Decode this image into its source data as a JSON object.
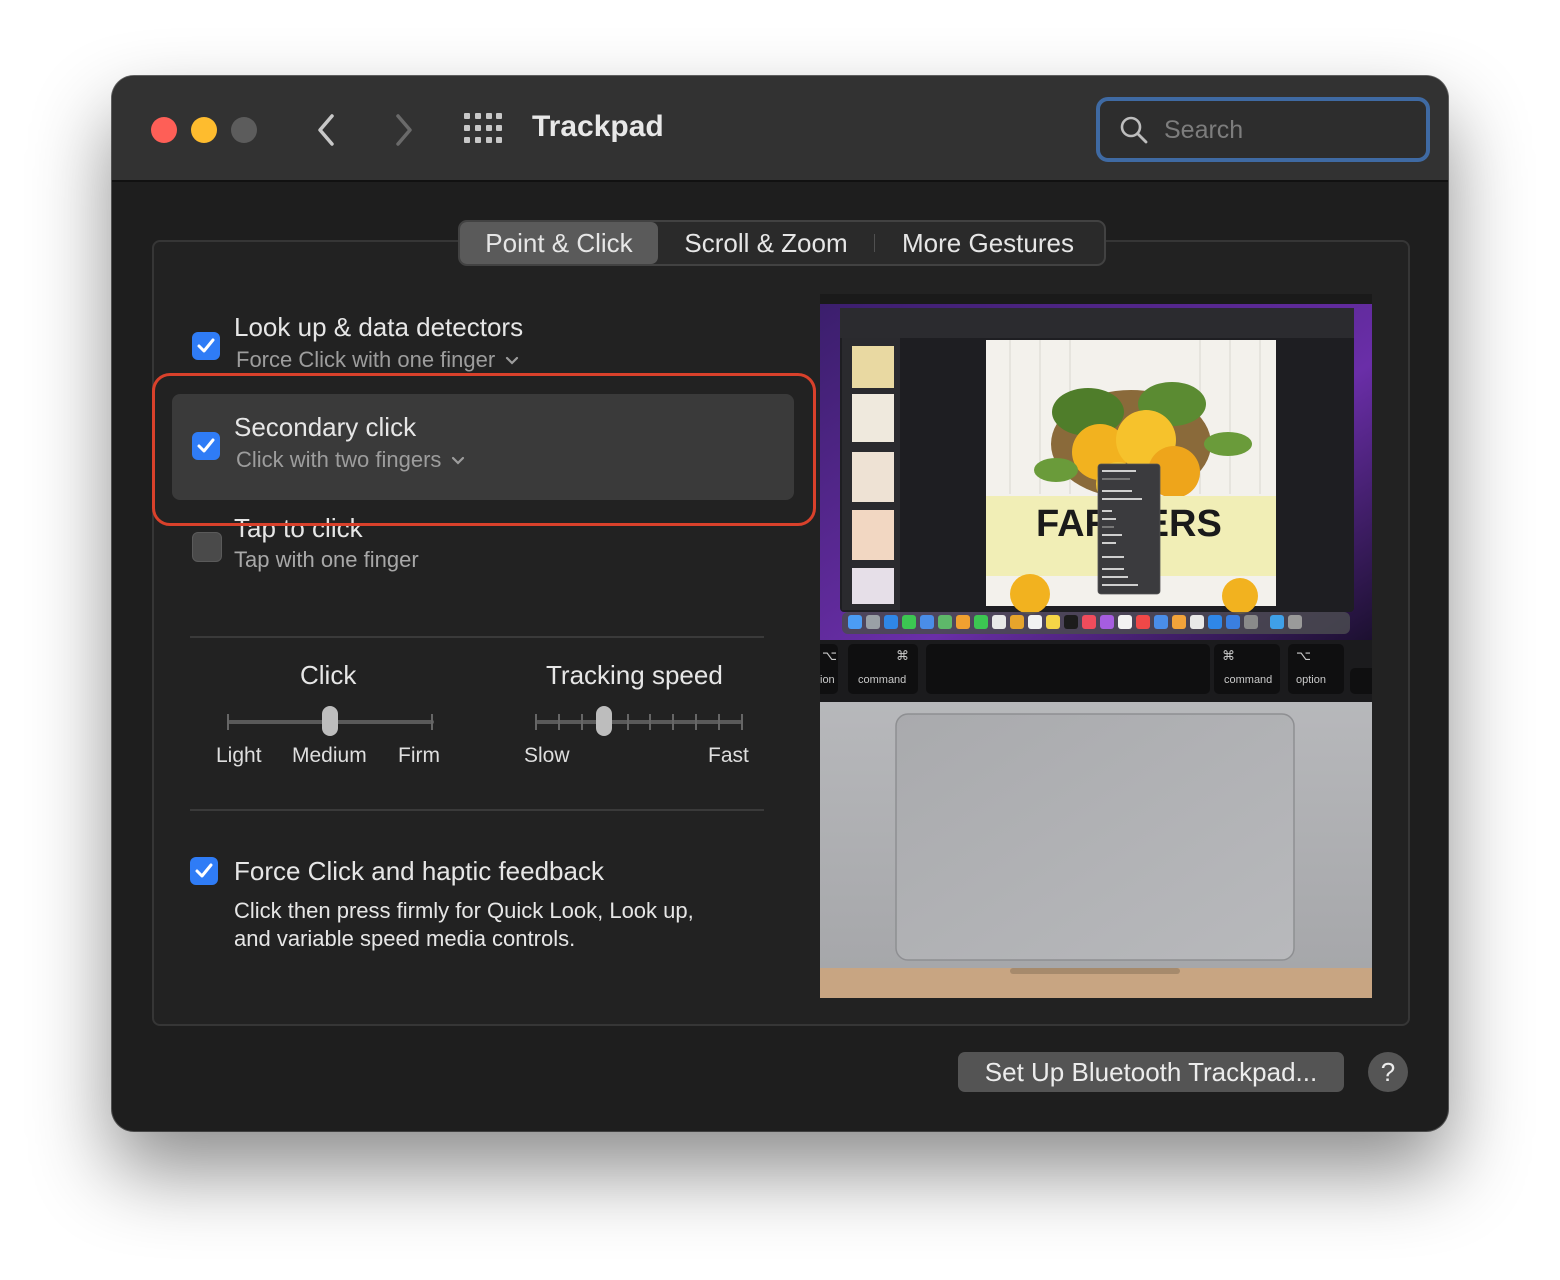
{
  "window": {
    "title": "Trackpad"
  },
  "search": {
    "placeholder": "Search"
  },
  "tabs": [
    {
      "label": "Point & Click",
      "active": true
    },
    {
      "label": "Scroll & Zoom",
      "active": false
    },
    {
      "label": "More Gestures",
      "active": false
    }
  ],
  "options": {
    "lookup": {
      "title": "Look up & data detectors",
      "subtitle": "Force Click with one finger",
      "checked": true
    },
    "secondary": {
      "title": "Secondary click",
      "subtitle": "Click with two fingers",
      "checked": true
    },
    "tap": {
      "title": "Tap to click",
      "subtitle": "Tap with one finger",
      "checked": false
    },
    "force": {
      "title": "Force Click and haptic feedback",
      "description_line1": "Click then press firmly for Quick Look, Look up,",
      "description_line2": "and variable speed media controls.",
      "checked": true
    }
  },
  "click_slider": {
    "title": "Click",
    "labels": [
      "Light",
      "Medium",
      "Firm"
    ],
    "value": "Medium"
  },
  "tracking_slider": {
    "title": "Tracking speed",
    "min_label": "Slow",
    "max_label": "Fast",
    "level": 0.33
  },
  "preview": {
    "poster_title": "FARMERS",
    "keys": {
      "left_cmd": "command",
      "right_cmd": "command",
      "option": "option",
      "ion": "ion",
      "cmd_symbol": "⌘",
      "opt_symbol": "⌥"
    }
  },
  "buttons": {
    "setup": "Set Up Bluetooth Trackpad...",
    "help": "?"
  },
  "colors": {
    "accent": "#2f7cf6",
    "highlight": "#d9412b",
    "search_ring": "#3f6aa3"
  }
}
